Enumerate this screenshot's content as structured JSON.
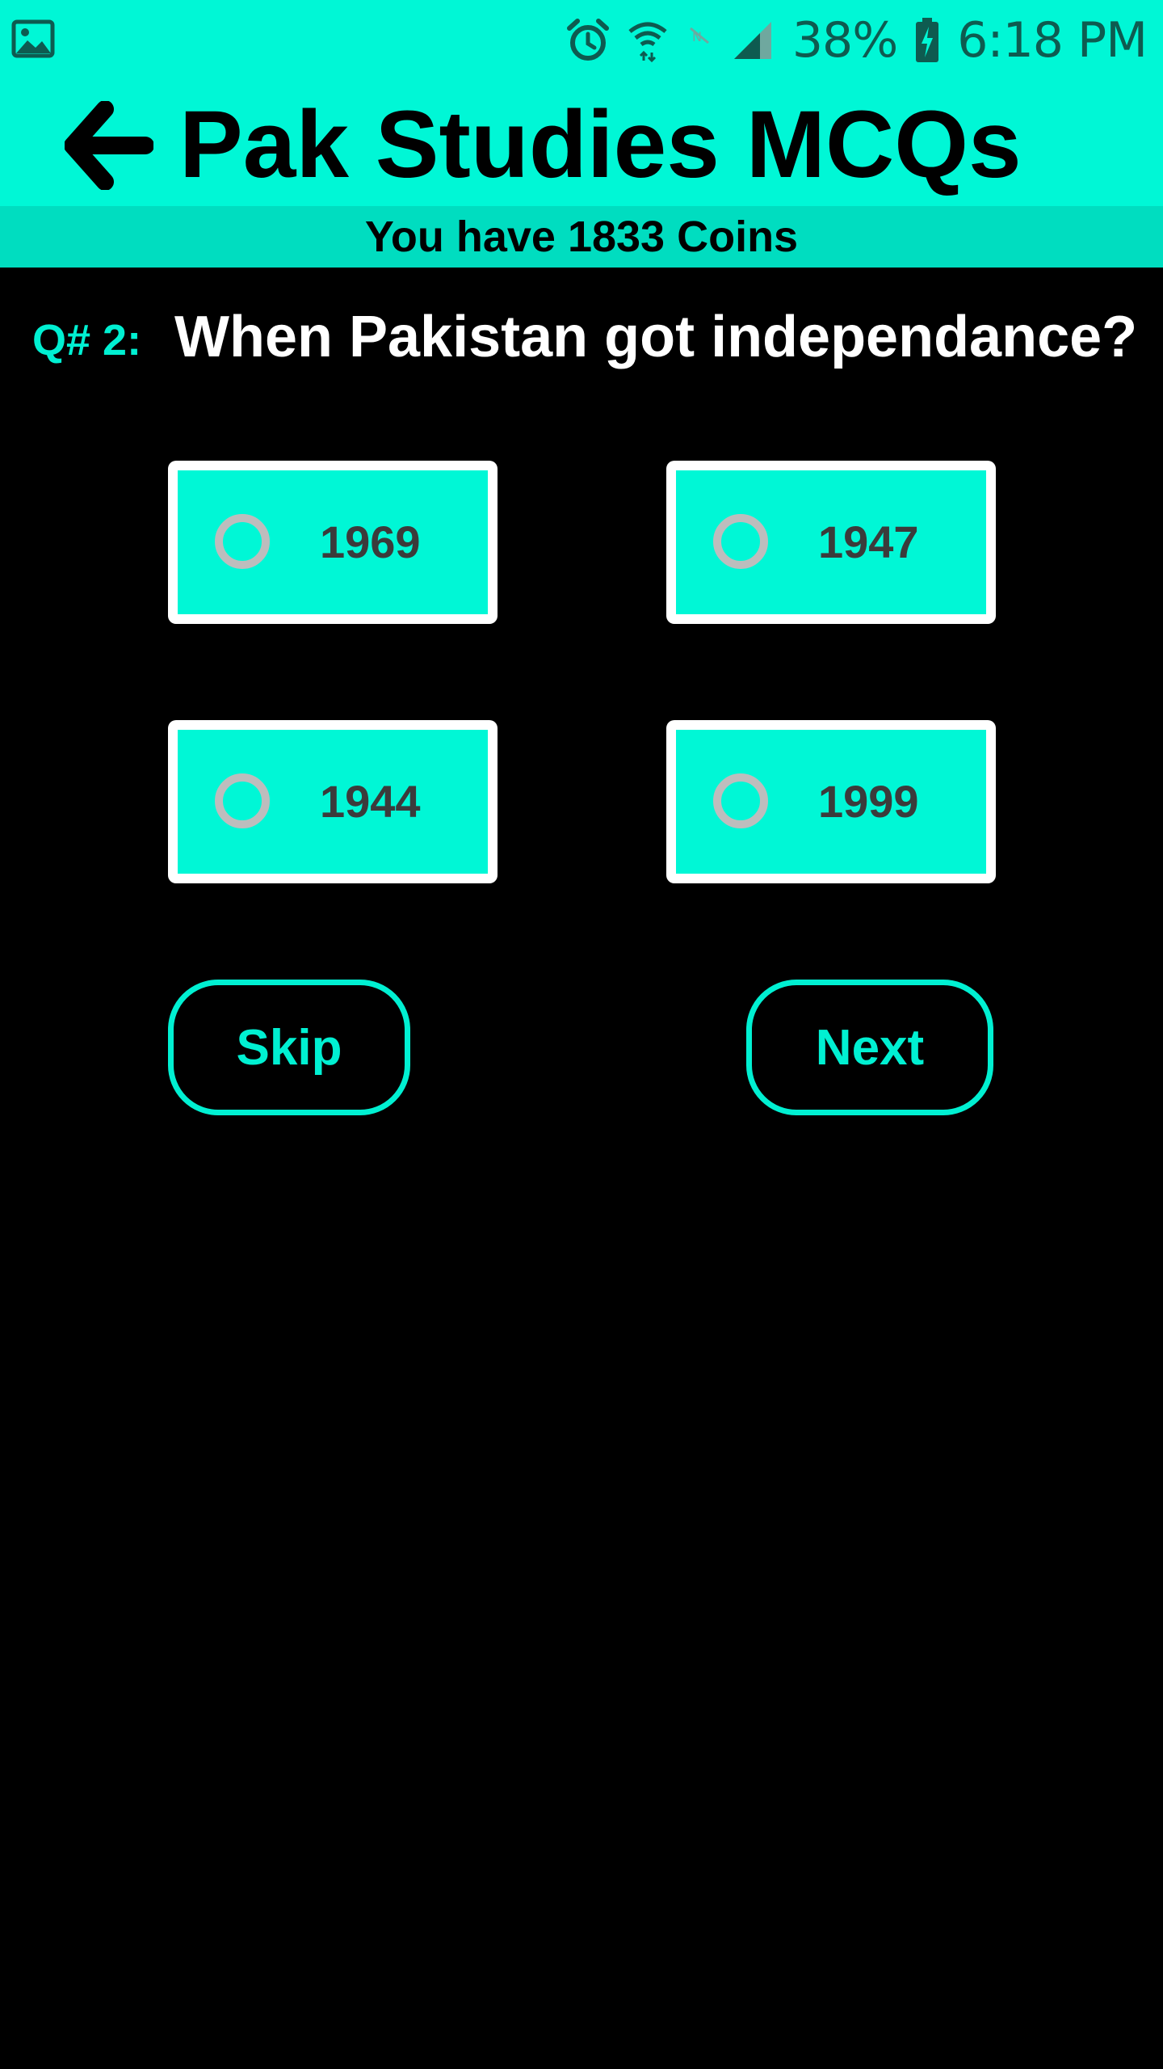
{
  "status_bar": {
    "battery_percent": "38%",
    "time": "6:18 PM",
    "icons": [
      "image-icon",
      "alarm-icon",
      "wifi-icon",
      "no-sim-icon",
      "signal-icon",
      "battery-charging-icon"
    ]
  },
  "app_bar": {
    "title": "Pak Studies MCQs",
    "back_icon": "arrow-left-icon"
  },
  "coins": {
    "text": "You have 1833 Coins"
  },
  "question": {
    "number_label": "Q# 2:",
    "text": "When Pakistan got independance?"
  },
  "options": [
    {
      "label": "1969",
      "selected": false
    },
    {
      "label": "1947",
      "selected": false
    },
    {
      "label": "1944",
      "selected": false
    },
    {
      "label": "1999",
      "selected": false
    }
  ],
  "buttons": {
    "skip_label": "Skip",
    "next_label": "Next"
  },
  "colors": {
    "accent": "#00f7d6",
    "coins_bar": "#00ddc0",
    "background": "#000000",
    "option_border": "#ffffff",
    "radio": "#bdbdbd",
    "option_text": "#3b3b3b"
  }
}
